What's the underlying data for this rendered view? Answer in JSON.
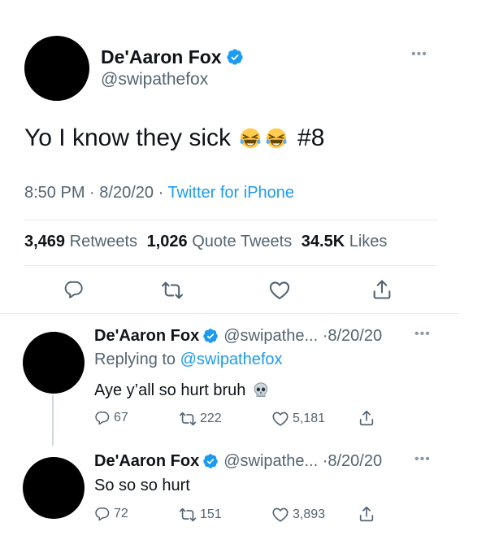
{
  "main_tweet": {
    "name": "De'Aaron Fox",
    "handle": "@swipathefox",
    "text": "Yo I know they sick",
    "hashtag": "#8",
    "time": "8:50 PM",
    "date": "8/20/20",
    "source": "Twitter for iPhone",
    "retweets_count": "3,469",
    "retweets_label": "Retweets",
    "quotes_count": "1,026",
    "quotes_label": "Quote Tweets",
    "likes_count": "34.5K",
    "likes_label": "Likes"
  },
  "replies": [
    {
      "name": "De'Aaron Fox",
      "handle": "@swipathe...",
      "date": "8/20/20",
      "replying_label": "Replying to",
      "replying_handle": "@swipathefox",
      "text": "Aye y’all so hurt bruh",
      "replies": "67",
      "retweets": "222",
      "likes": "5,181"
    },
    {
      "name": "De'Aaron Fox",
      "handle": "@swipathe...",
      "date": "8/20/20",
      "text": "So so so hurt",
      "replies": "72",
      "retweets": "151",
      "likes": "3,893"
    }
  ],
  "colors": {
    "accent": "#1d9bf0",
    "secondary_text": "#536471",
    "primary_text": "#0f1419"
  },
  "icons": [
    "verified-badge-icon",
    "reply-icon",
    "retweet-icon",
    "like-icon",
    "share-icon",
    "more-icon",
    "laughing-emoji-icon",
    "skull-emoji-icon"
  ]
}
